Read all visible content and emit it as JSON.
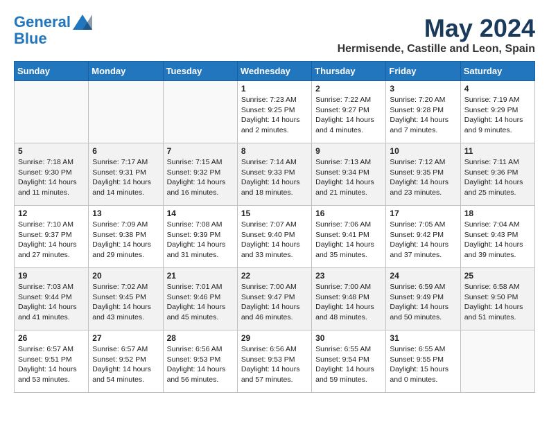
{
  "header": {
    "logo_line1": "General",
    "logo_line2": "Blue",
    "month_title": "May 2024",
    "location": "Hermisende, Castille and Leon, Spain"
  },
  "weekdays": [
    "Sunday",
    "Monday",
    "Tuesday",
    "Wednesday",
    "Thursday",
    "Friday",
    "Saturday"
  ],
  "weeks": [
    [
      {
        "day": "",
        "info": ""
      },
      {
        "day": "",
        "info": ""
      },
      {
        "day": "",
        "info": ""
      },
      {
        "day": "1",
        "info": "Sunrise: 7:23 AM\nSunset: 9:25 PM\nDaylight: 14 hours\nand 2 minutes."
      },
      {
        "day": "2",
        "info": "Sunrise: 7:22 AM\nSunset: 9:27 PM\nDaylight: 14 hours\nand 4 minutes."
      },
      {
        "day": "3",
        "info": "Sunrise: 7:20 AM\nSunset: 9:28 PM\nDaylight: 14 hours\nand 7 minutes."
      },
      {
        "day": "4",
        "info": "Sunrise: 7:19 AM\nSunset: 9:29 PM\nDaylight: 14 hours\nand 9 minutes."
      }
    ],
    [
      {
        "day": "5",
        "info": "Sunrise: 7:18 AM\nSunset: 9:30 PM\nDaylight: 14 hours\nand 11 minutes."
      },
      {
        "day": "6",
        "info": "Sunrise: 7:17 AM\nSunset: 9:31 PM\nDaylight: 14 hours\nand 14 minutes."
      },
      {
        "day": "7",
        "info": "Sunrise: 7:15 AM\nSunset: 9:32 PM\nDaylight: 14 hours\nand 16 minutes."
      },
      {
        "day": "8",
        "info": "Sunrise: 7:14 AM\nSunset: 9:33 PM\nDaylight: 14 hours\nand 18 minutes."
      },
      {
        "day": "9",
        "info": "Sunrise: 7:13 AM\nSunset: 9:34 PM\nDaylight: 14 hours\nand 21 minutes."
      },
      {
        "day": "10",
        "info": "Sunrise: 7:12 AM\nSunset: 9:35 PM\nDaylight: 14 hours\nand 23 minutes."
      },
      {
        "day": "11",
        "info": "Sunrise: 7:11 AM\nSunset: 9:36 PM\nDaylight: 14 hours\nand 25 minutes."
      }
    ],
    [
      {
        "day": "12",
        "info": "Sunrise: 7:10 AM\nSunset: 9:37 PM\nDaylight: 14 hours\nand 27 minutes."
      },
      {
        "day": "13",
        "info": "Sunrise: 7:09 AM\nSunset: 9:38 PM\nDaylight: 14 hours\nand 29 minutes."
      },
      {
        "day": "14",
        "info": "Sunrise: 7:08 AM\nSunset: 9:39 PM\nDaylight: 14 hours\nand 31 minutes."
      },
      {
        "day": "15",
        "info": "Sunrise: 7:07 AM\nSunset: 9:40 PM\nDaylight: 14 hours\nand 33 minutes."
      },
      {
        "day": "16",
        "info": "Sunrise: 7:06 AM\nSunset: 9:41 PM\nDaylight: 14 hours\nand 35 minutes."
      },
      {
        "day": "17",
        "info": "Sunrise: 7:05 AM\nSunset: 9:42 PM\nDaylight: 14 hours\nand 37 minutes."
      },
      {
        "day": "18",
        "info": "Sunrise: 7:04 AM\nSunset: 9:43 PM\nDaylight: 14 hours\nand 39 minutes."
      }
    ],
    [
      {
        "day": "19",
        "info": "Sunrise: 7:03 AM\nSunset: 9:44 PM\nDaylight: 14 hours\nand 41 minutes."
      },
      {
        "day": "20",
        "info": "Sunrise: 7:02 AM\nSunset: 9:45 PM\nDaylight: 14 hours\nand 43 minutes."
      },
      {
        "day": "21",
        "info": "Sunrise: 7:01 AM\nSunset: 9:46 PM\nDaylight: 14 hours\nand 45 minutes."
      },
      {
        "day": "22",
        "info": "Sunrise: 7:00 AM\nSunset: 9:47 PM\nDaylight: 14 hours\nand 46 minutes."
      },
      {
        "day": "23",
        "info": "Sunrise: 7:00 AM\nSunset: 9:48 PM\nDaylight: 14 hours\nand 48 minutes."
      },
      {
        "day": "24",
        "info": "Sunrise: 6:59 AM\nSunset: 9:49 PM\nDaylight: 14 hours\nand 50 minutes."
      },
      {
        "day": "25",
        "info": "Sunrise: 6:58 AM\nSunset: 9:50 PM\nDaylight: 14 hours\nand 51 minutes."
      }
    ],
    [
      {
        "day": "26",
        "info": "Sunrise: 6:57 AM\nSunset: 9:51 PM\nDaylight: 14 hours\nand 53 minutes."
      },
      {
        "day": "27",
        "info": "Sunrise: 6:57 AM\nSunset: 9:52 PM\nDaylight: 14 hours\nand 54 minutes."
      },
      {
        "day": "28",
        "info": "Sunrise: 6:56 AM\nSunset: 9:53 PM\nDaylight: 14 hours\nand 56 minutes."
      },
      {
        "day": "29",
        "info": "Sunrise: 6:56 AM\nSunset: 9:53 PM\nDaylight: 14 hours\nand 57 minutes."
      },
      {
        "day": "30",
        "info": "Sunrise: 6:55 AM\nSunset: 9:54 PM\nDaylight: 14 hours\nand 59 minutes."
      },
      {
        "day": "31",
        "info": "Sunrise: 6:55 AM\nSunset: 9:55 PM\nDaylight: 15 hours\nand 0 minutes."
      },
      {
        "day": "",
        "info": ""
      }
    ]
  ]
}
